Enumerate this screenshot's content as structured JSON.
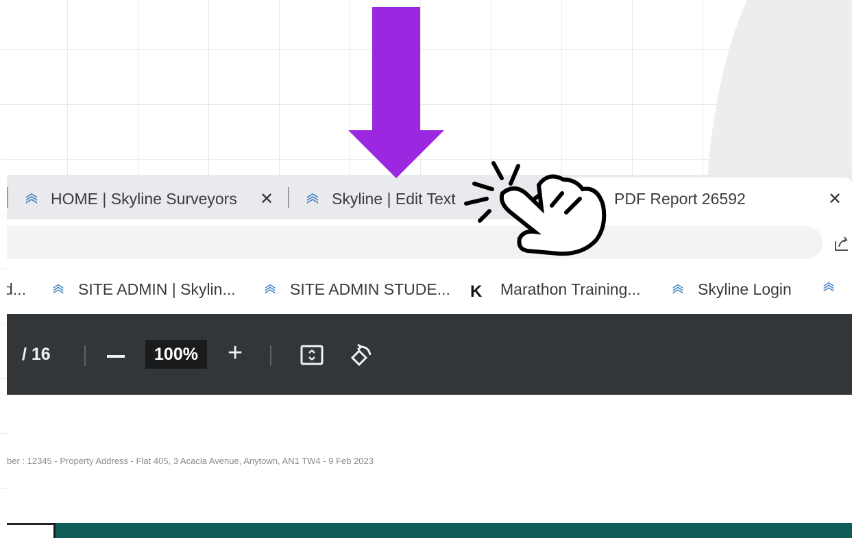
{
  "tabs": [
    {
      "label": "HOME | Skyline Surveyors",
      "icon": "skyline-favicon",
      "active": false
    },
    {
      "label": "Skyline | Edit Text",
      "icon": "skyline-favicon",
      "active": false
    },
    {
      "label": "PDF Report 26592",
      "icon": "globe-favicon",
      "active": true
    }
  ],
  "bookmarks": [
    {
      "label": "d...",
      "icon": null
    },
    {
      "label": "SITE ADMIN | Skylin...",
      "icon": "skyline-favicon"
    },
    {
      "label": "SITE ADMIN STUDE...",
      "icon": "skyline-favicon"
    },
    {
      "label": "Marathon Training...",
      "icon": "k-favicon"
    },
    {
      "label": "Skyline Login",
      "icon": "skyline-favicon"
    }
  ],
  "pdf_toolbar": {
    "page_total": "/ 16",
    "zoom": "100%"
  },
  "pdf_page": {
    "footer": "ber : 12345 - Property Address - Flat 405, 3 Acacia Avenue, Anytown, AN1 TW4 - 9 Feb 2023"
  },
  "colors": {
    "arrow": "#9b27e0",
    "pdf_toolbar": "#323639",
    "teal_band": "#0f5d58"
  },
  "annotations": {
    "arrow_icon": "down-arrow-icon",
    "pointer_icon": "click-hand-icon"
  }
}
